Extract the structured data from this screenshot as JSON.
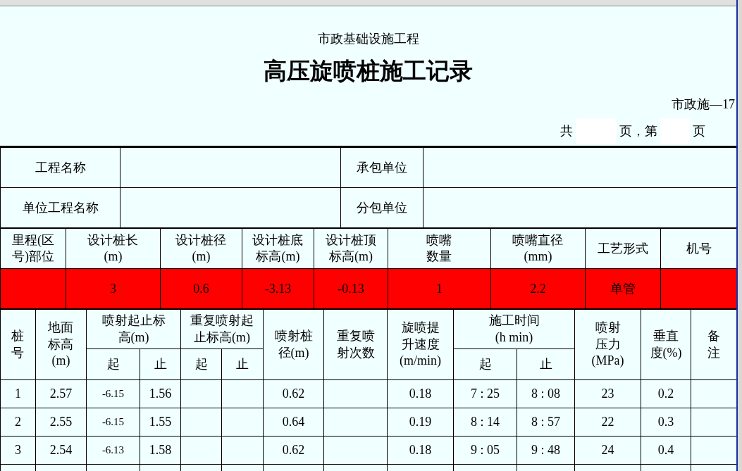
{
  "header": {
    "subtitle": "市政基础设施工程",
    "title": "高压旋喷桩施工记录",
    "form_code": "市政施—17",
    "page_total_label": "共",
    "page_mid_label": "页，第",
    "page_end_label": "页"
  },
  "info_fields": [
    {
      "label": "工程名称"
    },
    {
      "label": "承包单位"
    },
    {
      "label": "单位工程名称"
    },
    {
      "label": "分包单位"
    }
  ],
  "design": [
    {
      "header": "里程(区号)部位"
    },
    {
      "header": "设计桩长(m)",
      "value": "3"
    },
    {
      "header": "设计桩径(m)",
      "value": "0.6"
    },
    {
      "header": "设计桩底标高(m)",
      "value": "-3.13"
    },
    {
      "header": "设计桩顶标高(m)",
      "value": "-0.13"
    },
    {
      "header": "喷嘴数量",
      "value": "1"
    },
    {
      "header": "喷嘴直径(mm)",
      "value": "2.2"
    },
    {
      "header": "工艺形式",
      "value": "单管"
    },
    {
      "header": "机号"
    }
  ],
  "record_headers": {
    "pile_no": "桩号",
    "ground": "地面标高(m)",
    "jet_range": "喷射起止标高(m)",
    "jet_start": "起",
    "jet_end": "止",
    "repeat_range": "重复喷射起止标高(m)",
    "repeat_start": "起",
    "repeat_end": "止",
    "diameter": "喷射桩径(m)",
    "repeat_count": "重复喷射次数",
    "speed": "旋喷提升速度(m/min)",
    "time": "施工时间(h min)",
    "time_start": "起",
    "time_end": "止",
    "pressure": "喷射压力(MPa)",
    "verticality": "垂直度(%)",
    "remark": "备注"
  },
  "records": [
    {
      "pile_no": "1",
      "ground": "2.57",
      "jet_start": "-6.15",
      "jet_end": "1.56",
      "diameter": "0.62",
      "speed": "0.18",
      "time_start": "7 : 25",
      "time_end": "8 : 08",
      "pressure": "23",
      "verticality": "0.2"
    },
    {
      "pile_no": "2",
      "ground": "2.55",
      "jet_start": "-6.15",
      "jet_end": "1.55",
      "diameter": "0.64",
      "speed": "0.19",
      "time_start": "8 : 14",
      "time_end": "8 : 57",
      "pressure": "22",
      "verticality": "0.3"
    },
    {
      "pile_no": "3",
      "ground": "2.54",
      "jet_start": "-6.13",
      "jet_end": "1.58",
      "diameter": "0.62",
      "speed": "0.18",
      "time_start": "9 : 05",
      "time_end": "9 : 48",
      "pressure": "24",
      "verticality": "0.4"
    }
  ]
}
